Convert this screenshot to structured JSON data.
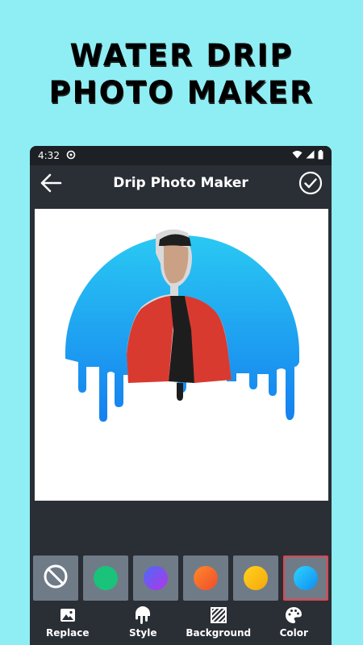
{
  "promo": {
    "line1": "WATER DRIP",
    "line2": "PHOTO MAKER"
  },
  "status_bar": {
    "time": "4:32"
  },
  "toolbar": {
    "title": "Drip Photo Maker",
    "back_icon": "arrow-left-icon",
    "done_icon": "check-circle-icon"
  },
  "swatches": [
    {
      "name": "none",
      "icon": "no-color-icon"
    },
    {
      "name": "green",
      "color": "#19c37a"
    },
    {
      "name": "purple",
      "color": "#7a4cf0"
    },
    {
      "name": "orange",
      "color": "#f56a2a"
    },
    {
      "name": "yellow",
      "color": "#f9b812"
    },
    {
      "name": "blue",
      "color": "#1ab4f5",
      "selected": true
    }
  ],
  "bottom_nav": [
    {
      "label": "Replace",
      "icon": "image-icon"
    },
    {
      "label": "Style",
      "icon": "drip-icon"
    },
    {
      "label": "Background",
      "icon": "texture-icon"
    },
    {
      "label": "Color",
      "icon": "palette-icon"
    }
  ],
  "colors": {
    "page_bg": "#8eeef4",
    "phone_bg": "#2a2e35",
    "accent_selected": "#e8414c",
    "drip_gradient_top": "#2ac9f2",
    "drip_gradient_bottom": "#1580f0"
  }
}
